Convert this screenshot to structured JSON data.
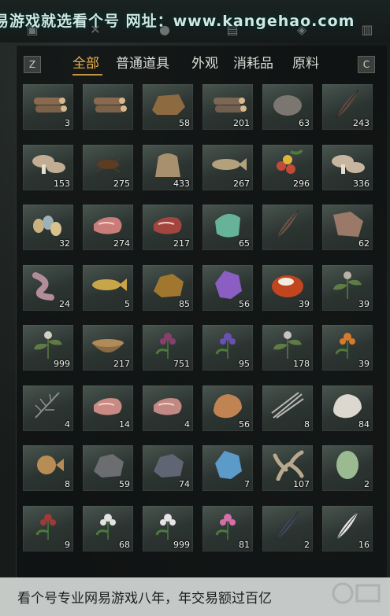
{
  "watermark_top": "易游戏就选看个号  网址：www.kangehao.com",
  "watermark_bottom": "看个号专业网易游戏八年，年交易额过百亿",
  "key_left": "Z",
  "key_right": "C",
  "tabs": [
    {
      "label": "全部"
    },
    {
      "label": "普通道具"
    },
    {
      "label": "外观"
    },
    {
      "label": "消耗品"
    },
    {
      "label": "原料"
    }
  ],
  "items": [
    {
      "icon": "logs-icon",
      "count": "3",
      "color": "#8a6a4e"
    },
    {
      "icon": "logs-icon",
      "count": "",
      "color": "#8a6a4e"
    },
    {
      "icon": "bark-icon",
      "count": "58",
      "color": "#8e6a40"
    },
    {
      "icon": "logs-icon",
      "count": "201",
      "color": "#7d6654"
    },
    {
      "icon": "stone-icon",
      "count": "63",
      "color": "#7b7670"
    },
    {
      "icon": "feather-icon",
      "count": "243",
      "color": "#5e4a40"
    },
    {
      "icon": "mushroom-icon",
      "count": "153",
      "color": "#c0ad93"
    },
    {
      "icon": "insect-icon",
      "count": "275",
      "color": "#5c3c22"
    },
    {
      "icon": "grain-sack-icon",
      "count": "433",
      "color": "#a8906e"
    },
    {
      "icon": "fish-icon",
      "count": "267",
      "color": "#b3a17e"
    },
    {
      "icon": "berries-icon",
      "count": "296",
      "color": "#c24a38"
    },
    {
      "icon": "mushroom-icon",
      "count": "336",
      "color": "#c8b5a0"
    },
    {
      "icon": "eggs-icon",
      "count": "32",
      "color": "#c9b27d"
    },
    {
      "icon": "meat-icon",
      "count": "274",
      "color": "#c97c79"
    },
    {
      "icon": "meat-icon",
      "count": "217",
      "color": "#a3453f"
    },
    {
      "icon": "jade-icon",
      "count": "65",
      "color": "#66b39a"
    },
    {
      "icon": "feather-icon",
      "count": "",
      "color": "#6a5548"
    },
    {
      "icon": "hide-icon",
      "count": "62",
      "color": "#9a7968"
    },
    {
      "icon": "intestine-icon",
      "count": "24",
      "color": "#b38c9b"
    },
    {
      "icon": "fish-icon",
      "count": "5",
      "color": "#c9a54a"
    },
    {
      "icon": "ore-icon",
      "count": "85",
      "color": "#a1772f"
    },
    {
      "icon": "crystal-icon",
      "count": "56",
      "color": "#8a5ec2"
    },
    {
      "icon": "amber-icon",
      "count": "39",
      "color": "#c3451f"
    },
    {
      "icon": "herb-icon",
      "count": "39",
      "color": "#b9b3a6"
    },
    {
      "icon": "herb-icon",
      "count": "999",
      "color": "#d2cfc3"
    },
    {
      "icon": "grain-bowl-icon",
      "count": "217",
      "color": "#8a6a45"
    },
    {
      "icon": "flower-icon",
      "count": "751",
      "color": "#8a3f6a"
    },
    {
      "icon": "flower-icon",
      "count": "95",
      "color": "#6b4fb4"
    },
    {
      "icon": "herb-icon",
      "count": "178",
      "color": "#c9c3c0"
    },
    {
      "icon": "flower-icon",
      "count": "39",
      "color": "#d77a2a"
    },
    {
      "icon": "branch-icon",
      "count": "4",
      "color": "#8b8f8e"
    },
    {
      "icon": "meat-icon",
      "count": "14",
      "color": "#c98a84"
    },
    {
      "icon": "meat-icon",
      "count": "4",
      "color": "#c28883"
    },
    {
      "icon": "fur-icon",
      "count": "56",
      "color": "#c08452"
    },
    {
      "icon": "quills-icon",
      "count": "8",
      "color": "#b9b9b6"
    },
    {
      "icon": "fur-icon",
      "count": "84",
      "color": "#dcd8cf"
    },
    {
      "icon": "pufferfish-icon",
      "count": "8",
      "color": "#b88c55"
    },
    {
      "icon": "ore-icon",
      "count": "59",
      "color": "#6b6d70"
    },
    {
      "icon": "ore-icon",
      "count": "74",
      "color": "#5f6572"
    },
    {
      "icon": "crystal-icon",
      "count": "7",
      "color": "#5c9ac9"
    },
    {
      "icon": "root-icon",
      "count": "107",
      "color": "#b8a98e"
    },
    {
      "icon": "egg-icon",
      "count": "2",
      "color": "#9bba92"
    },
    {
      "icon": "flower-icon",
      "count": "9",
      "color": "#9e3a38"
    },
    {
      "icon": "flower-icon",
      "count": "68",
      "color": "#e2e2e2"
    },
    {
      "icon": "flower-icon",
      "count": "999",
      "color": "#e6e2e6"
    },
    {
      "icon": "flower-icon",
      "count": "81",
      "color": "#d86ea6"
    },
    {
      "icon": "feather-icon",
      "count": "2",
      "color": "#3e4858"
    },
    {
      "icon": "feather-icon",
      "count": "16",
      "color": "#e4e4e4"
    }
  ]
}
